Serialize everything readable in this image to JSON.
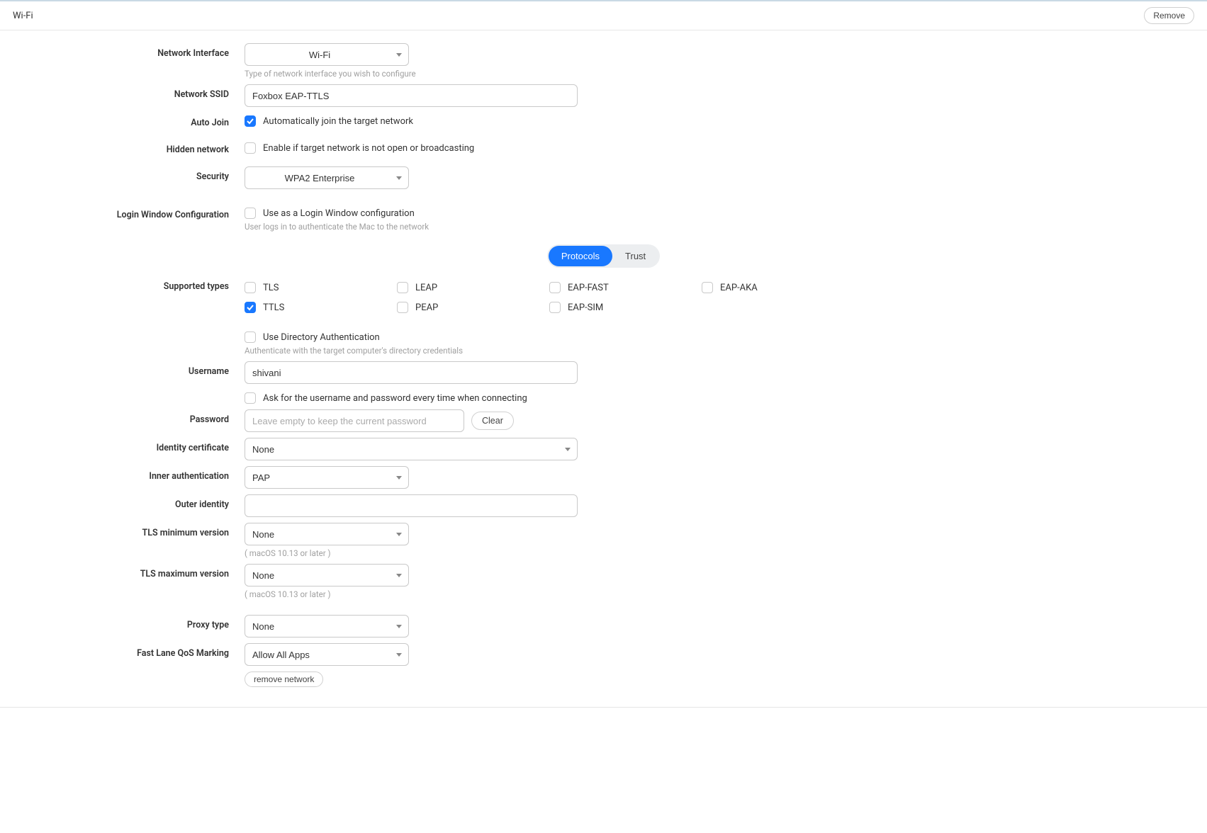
{
  "header": {
    "title": "Wi-Fi",
    "remove_label": "Remove"
  },
  "labels": {
    "network_interface": "Network Interface",
    "network_ssid": "Network SSID",
    "auto_join": "Auto Join",
    "hidden_network": "Hidden network",
    "security": "Security",
    "login_window_conf": "Login Window Configuration",
    "supported_types": "Supported types",
    "username": "Username",
    "password": "Password",
    "identity_cert": "Identity certificate",
    "inner_auth": "Inner authentication",
    "outer_identity": "Outer identity",
    "tls_min": "TLS minimum version",
    "tls_max": "TLS maximum version",
    "proxy_type": "Proxy type",
    "fastlane": "Fast Lane QoS Marking"
  },
  "values": {
    "network_interface": "Wi-Fi",
    "network_ssid": "Foxbox EAP-TTLS",
    "security": "WPA2 Enterprise",
    "username": "shivani",
    "identity_cert": "None",
    "inner_auth": "PAP",
    "outer_identity": "",
    "tls_min": "None",
    "tls_max": "None",
    "proxy_type": "None",
    "fastlane": "Allow All Apps"
  },
  "helpers": {
    "network_interface": "Type of network interface you wish to configure",
    "login_window": "User logs in to authenticate the Mac to the network",
    "dir_auth": "Authenticate with the target computer's directory credentials",
    "tls_note": "( macOS 10.13 or later )"
  },
  "checkboxes": {
    "auto_join_label": "Automatically join the target network",
    "hidden_label": "Enable if target network is not open or broadcasting",
    "login_window_label": "Use as a Login Window configuration",
    "dir_auth_label": "Use Directory Authentication",
    "ask_creds_label": "Ask for the username and password every time when connecting"
  },
  "checkbox_states": {
    "auto_join": true,
    "hidden": false,
    "login_window": false,
    "dir_auth": false,
    "ask_creds": false
  },
  "tabs": {
    "protocols": "Protocols",
    "trust": "Trust",
    "active": "protocols"
  },
  "types": [
    {
      "key": "tls",
      "label": "TLS",
      "checked": false
    },
    {
      "key": "leap",
      "label": "LEAP",
      "checked": false
    },
    {
      "key": "eapfast",
      "label": "EAP-FAST",
      "checked": false
    },
    {
      "key": "eapaka",
      "label": "EAP-AKA",
      "checked": false
    },
    {
      "key": "ttls",
      "label": "TTLS",
      "checked": true
    },
    {
      "key": "peap",
      "label": "PEAP",
      "checked": false
    },
    {
      "key": "eapsim",
      "label": "EAP-SIM",
      "checked": false
    }
  ],
  "placeholders": {
    "password": "Leave empty to keep the current password"
  },
  "buttons": {
    "clear": "Clear",
    "remove_network": "remove network"
  }
}
